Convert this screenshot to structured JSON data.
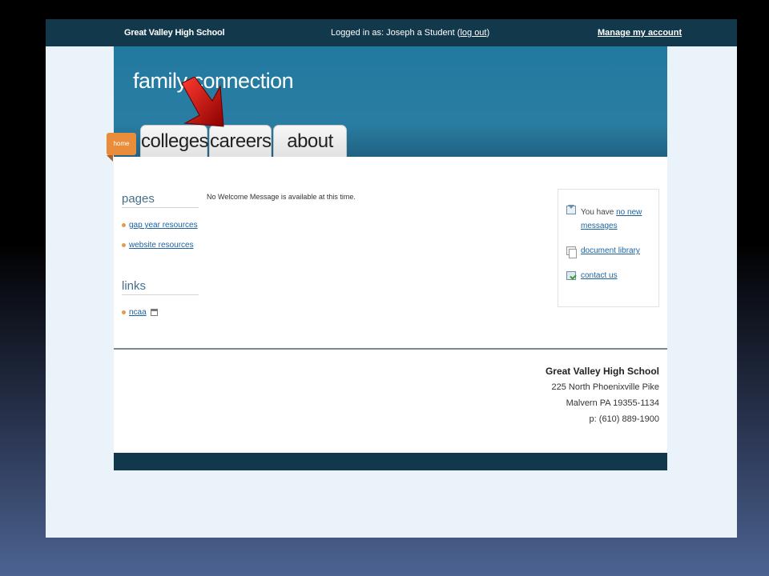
{
  "topbar": {
    "school_name": "Great Valley High School",
    "login_prefix": "Logged in as: Joseph a Student (",
    "logout_label": "log out",
    "login_suffix": ")",
    "manage_label": "Manage my account"
  },
  "header": {
    "brand": "family connection",
    "home_label": "home",
    "tabs": [
      {
        "label": "colleges"
      },
      {
        "label": "careers"
      },
      {
        "label": "about me"
      }
    ]
  },
  "sidebar": {
    "pages_heading": "pages",
    "pages": [
      {
        "label": "gap year resources"
      },
      {
        "label": "website resources"
      }
    ],
    "links_heading": "links",
    "links": [
      {
        "label": "ncaa"
      }
    ]
  },
  "main": {
    "welcome": "No Welcome Message is available at this time."
  },
  "messages": {
    "you_have": "You have ",
    "no_new_messages": "no new messages",
    "document_library": "document library",
    "contact_us": "contact us"
  },
  "footer": {
    "school_name": "Great Valley High School",
    "address1": "225 North Phoenixville Pike",
    "address2": "Malvern PA 19355-1134",
    "phone": "p: (610) 889-1900"
  },
  "colors": {
    "topbar": "#12394b",
    "header": "#2a7da2",
    "home_tab": "#e98d3a",
    "link": "#1c62a0",
    "arrow": "#cc0000"
  }
}
